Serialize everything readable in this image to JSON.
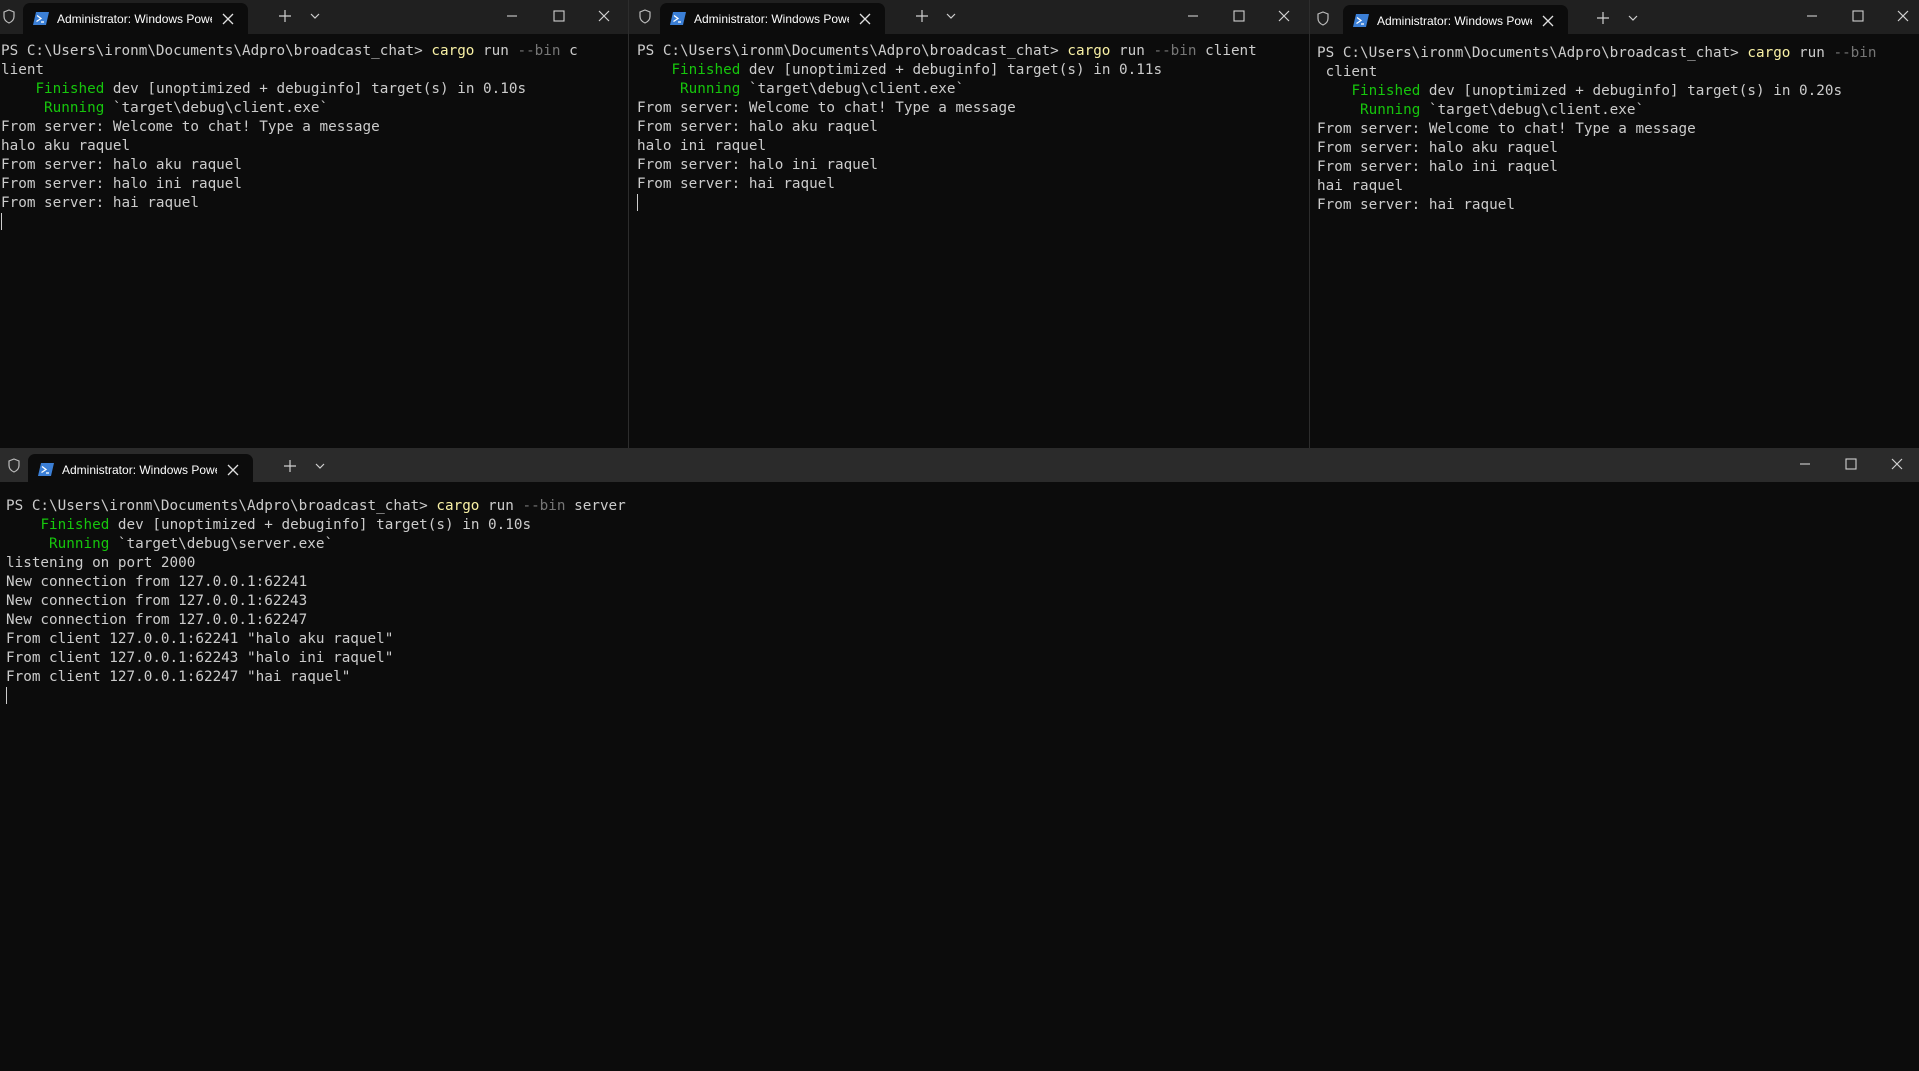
{
  "windows": [
    {
      "tab_title": "Administrator: Windows PowerShell",
      "lines": {
        "l1_prompt": "PS C:\\Users\\ironm\\Documents\\Adpro\\broadcast_chat> ",
        "l1_cmd": "cargo",
        "l1_args": " run ",
        "l1_flag": "--bin",
        "l1_rest": " c",
        "l2": "lient",
        "l3_status": "Finished",
        "l3_rest": " dev [unoptimized + debuginfo] target(s) in 0.10s",
        "l4_status": "Running",
        "l4_rest": " `target\\debug\\client.exe`",
        "l5": "From server: Welcome to chat! Type a message",
        "l6": "halo aku raquel",
        "l7": "From server: halo aku raquel",
        "l8": "From server: halo ini raquel",
        "l9": "From server: hai raquel"
      }
    },
    {
      "tab_title": "Administrator: Windows PowerShell",
      "lines": {
        "l1_prompt": "PS C:\\Users\\ironm\\Documents\\Adpro\\broadcast_chat> ",
        "l1_cmd": "cargo",
        "l1_args": " run ",
        "l1_flag": "--bin",
        "l1_rest": " client",
        "l2_status": "Finished",
        "l2_rest": " dev [unoptimized + debuginfo] target(s) in 0.11s",
        "l3_status": "Running",
        "l3_rest": " `target\\debug\\client.exe`",
        "l4": "From server: Welcome to chat! Type a message",
        "l5": "From server: halo aku raquel",
        "l6": "halo ini raquel",
        "l7": "From server: halo ini raquel",
        "l8": "From server: hai raquel"
      }
    },
    {
      "tab_title": "Administrator: Windows PowerShell",
      "lines": {
        "l1_prompt": "PS C:\\Users\\ironm\\Documents\\Adpro\\broadcast_chat> ",
        "l1_cmd": "cargo",
        "l1_args": " run ",
        "l1_flag": "--bin",
        "l2": " client",
        "l3_status": "Finished",
        "l3_rest": " dev [unoptimized + debuginfo] target(s) in 0.20s",
        "l4_status": "Running",
        "l4_rest": " `target\\debug\\client.exe`",
        "l5": "From server: Welcome to chat! Type a message",
        "l6": "From server: halo aku raquel",
        "l7": "From server: halo ini raquel",
        "l8": "hai raquel",
        "l9": "From server: hai raquel"
      }
    },
    {
      "tab_title": "Administrator: Windows PowerShell",
      "lines": {
        "l1_prompt": "PS C:\\Users\\ironm\\Documents\\Adpro\\broadcast_chat> ",
        "l1_cmd": "cargo",
        "l1_args": " run ",
        "l1_flag": "--bin",
        "l1_rest": " server",
        "l2_status": "Finished",
        "l2_rest": " dev [unoptimized + debuginfo] target(s) in 0.10s",
        "l3_status": "Running",
        "l3_rest": " `target\\debug\\server.exe`",
        "l4": "listening on port 2000",
        "l5": "New connection from 127.0.0.1:62241",
        "l6": "New connection from 127.0.0.1:62243",
        "l7": "New connection from 127.0.0.1:62247",
        "l8": "From client 127.0.0.1:62241 \"halo aku raquel\"",
        "l9": "From client 127.0.0.1:62243 \"halo ini raquel\"",
        "l10": "From client 127.0.0.1:62247 \"hai raquel\""
      }
    }
  ],
  "icons": {
    "shield": "shield-icon",
    "powershell": "powershell-icon",
    "close": "close-icon",
    "new_tab": "plus-icon",
    "dropdown": "chevron-down-icon",
    "minimize": "minimize-icon",
    "maximize": "maximize-icon"
  },
  "colors": {
    "background": "#0c0c0c",
    "titlebar": "#202020",
    "text": "#cccccc",
    "command": "#f9f1a5",
    "status": "#16c60c",
    "flag": "#767676"
  }
}
